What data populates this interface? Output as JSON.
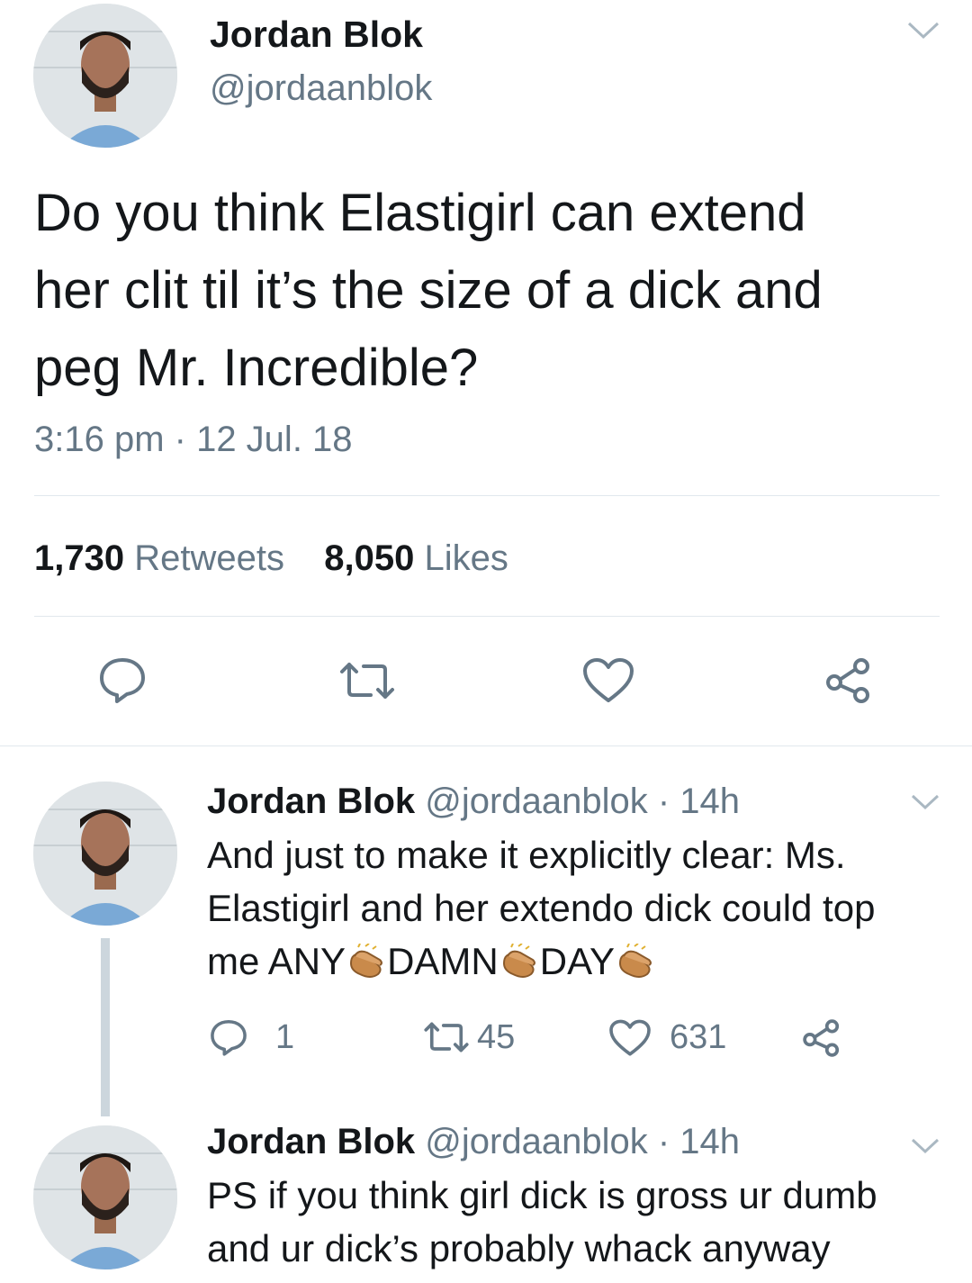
{
  "main_tweet": {
    "author_name": "Jordan Blok",
    "author_handle": "@jordaanblok",
    "text_lines": [
      "Do you think Elastigirl can extend",
      "her clit til it’s the size of a dick and",
      "peg Mr. Incredible?"
    ],
    "timestamp": "3:16 pm · 12 Jul. 18",
    "retweet_count": "1,730",
    "retweet_label": "Retweets",
    "like_count": "8,050",
    "like_label": "Likes",
    "actions": [
      "reply-icon",
      "retweet-icon",
      "like-icon",
      "share-icon"
    ]
  },
  "replies": [
    {
      "author_name": "Jordan Blok",
      "meta": "@jordaanblok · 14h",
      "line1": "And just to make it explicitly clear: Ms.",
      "line2": "Elastigirl and her extendo dick could top",
      "line3_parts": [
        "me ANY",
        "DAMN",
        "DAY"
      ],
      "reply_count": "1",
      "retweet_count": "45",
      "like_count": "631"
    },
    {
      "author_name": "Jordan Blok",
      "meta": "@jordaanblok · 14h",
      "line1": "PS if you think girl dick is gross ur dumb",
      "line2": "and ur dick’s probably whack anyway"
    }
  ],
  "colors": {
    "text": "#14171a",
    "muted": "#657786",
    "divider": "#e1e8ed",
    "thread_line": "#ccd6dd"
  }
}
